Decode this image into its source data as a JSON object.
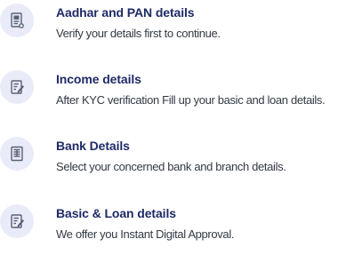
{
  "steps": [
    {
      "icon": "id-document-icon",
      "title": "Aadhar and PAN details",
      "description": "Verify your details first to continue."
    },
    {
      "icon": "form-edit-icon",
      "title": "Income details",
      "description": "After KYC verification Fill up your basic and loan details."
    },
    {
      "icon": "bank-card-icon",
      "title": "Bank Details",
      "description": "Select your concerned bank and branch details."
    },
    {
      "icon": "form-edit-icon",
      "title": "Basic & Loan details",
      "description": "We offer you Instant Digital Approval."
    }
  ],
  "colors": {
    "title": "#1f2a66",
    "description": "#333a44",
    "icon_bg": "#e9ecf8",
    "icon_stroke": "#5a6175"
  }
}
